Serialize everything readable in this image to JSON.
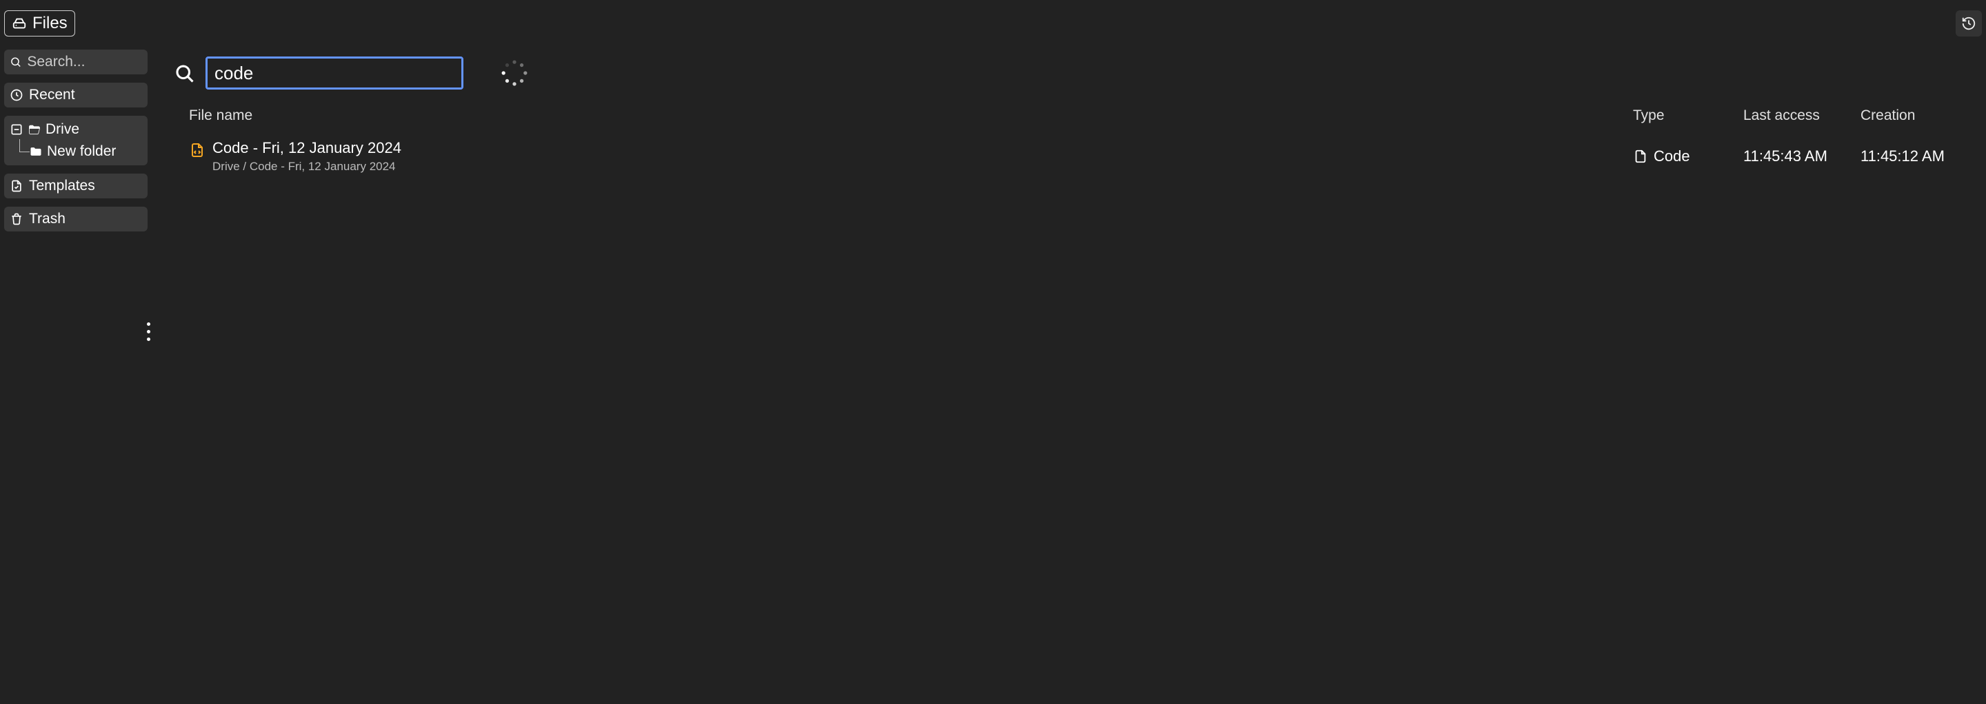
{
  "topbar": {
    "title": "Files"
  },
  "sidebar": {
    "search_placeholder": "Search...",
    "recent": "Recent",
    "drive": "Drive",
    "new_folder": "New folder",
    "templates": "Templates",
    "trash": "Trash"
  },
  "search": {
    "value": "code"
  },
  "columns": {
    "name": "File name",
    "type": "Type",
    "access": "Last access",
    "creation": "Creation"
  },
  "results": [
    {
      "name": "Code - Fri, 12 January 2024",
      "path": "Drive  /  Code - Fri, 12 January 2024",
      "type": "Code",
      "access": "11:45:43 AM",
      "creation": "11:45:12 AM"
    }
  ]
}
